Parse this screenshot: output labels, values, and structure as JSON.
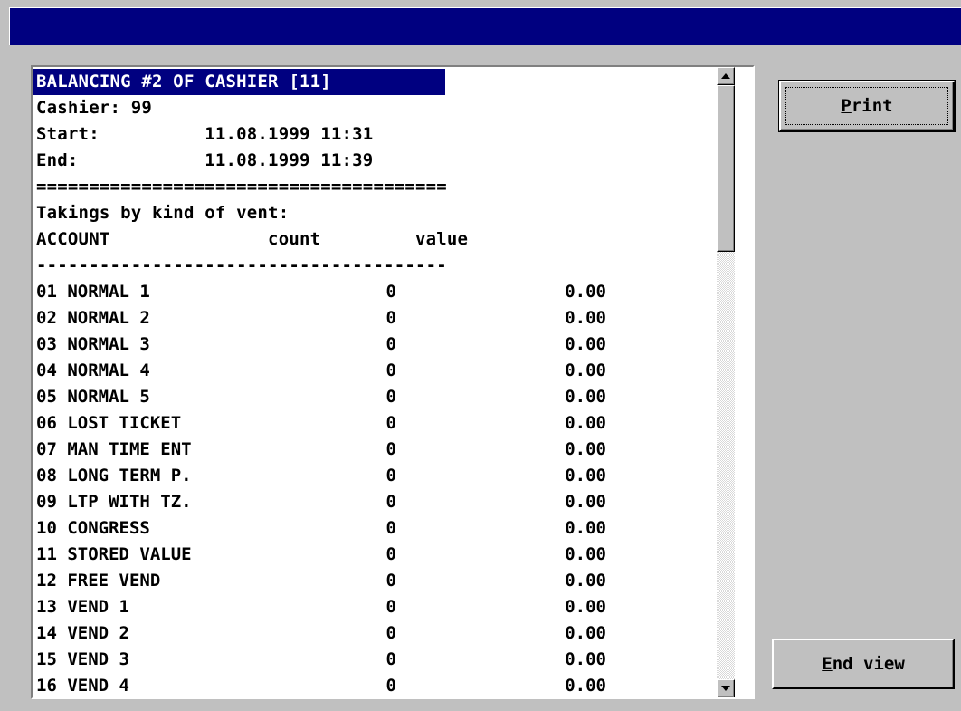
{
  "window": {
    "title": ""
  },
  "report": {
    "heading": "BALANCING #2 OF CASHIER [11]",
    "cashier_line": "Cashier: 99",
    "start_line": "Start:          11.08.1999 11:31",
    "end_line": "End:            11.08.1999 11:39",
    "double_rule": "=======================================",
    "section_title": "Takings by kind of vent:",
    "col_header_line": "ACCOUNT               count         value",
    "single_rule": "---------------------------------------",
    "rows": [
      {
        "account": "01 NORMAL 1",
        "count": "0",
        "value": "0.00"
      },
      {
        "account": "02 NORMAL 2",
        "count": "0",
        "value": "0.00"
      },
      {
        "account": "03 NORMAL 3",
        "count": "0",
        "value": "0.00"
      },
      {
        "account": "04 NORMAL 4",
        "count": "0",
        "value": "0.00"
      },
      {
        "account": "05 NORMAL 5",
        "count": "0",
        "value": "0.00"
      },
      {
        "account": "06 LOST TICKET",
        "count": "0",
        "value": "0.00"
      },
      {
        "account": "07 MAN TIME ENT",
        "count": "0",
        "value": "0.00"
      },
      {
        "account": "08 LONG TERM P.",
        "count": "0",
        "value": "0.00"
      },
      {
        "account": "09 LTP WITH TZ.",
        "count": "0",
        "value": "0.00"
      },
      {
        "account": "10 CONGRESS",
        "count": "0",
        "value": "0.00"
      },
      {
        "account": "11 STORED VALUE",
        "count": "0",
        "value": "0.00"
      },
      {
        "account": "12 FREE VEND",
        "count": "0",
        "value": "0.00"
      },
      {
        "account": "13 VEND 1",
        "count": "0",
        "value": "0.00"
      },
      {
        "account": "14 VEND 2",
        "count": "0",
        "value": "0.00"
      },
      {
        "account": "15 VEND 3",
        "count": "0",
        "value": "0.00"
      },
      {
        "account": "16 VEND 4",
        "count": "0",
        "value": "0.00"
      }
    ]
  },
  "buttons": {
    "print": {
      "hotkey": "P",
      "rest": "rint"
    },
    "end_view": {
      "hotkey": "E",
      "rest": "nd view"
    }
  },
  "icons": {
    "scroll_up": "triangle-up-icon",
    "scroll_down": "triangle-down-icon"
  },
  "colors": {
    "titlebar": "#000080",
    "heading_highlight": "#000080",
    "face": "#c0c0c0"
  }
}
